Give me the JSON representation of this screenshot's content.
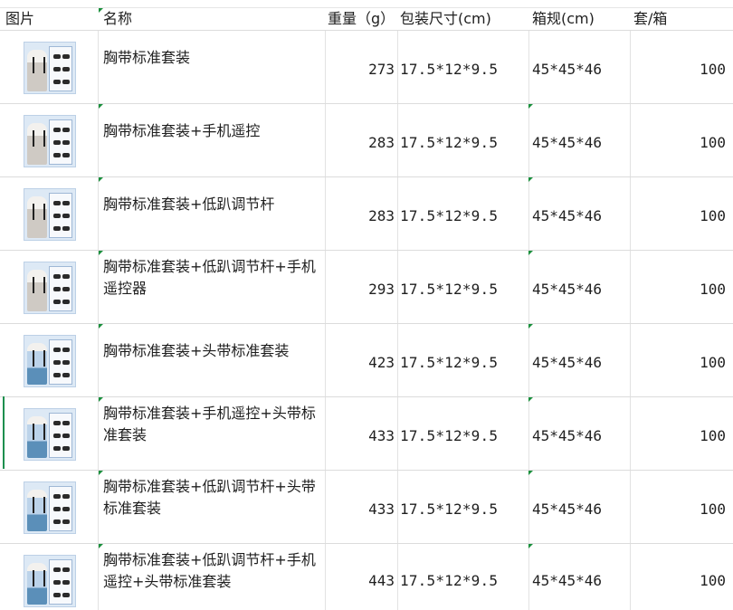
{
  "headers": {
    "picture": "图片",
    "name": "名称",
    "weight": "重量（g）",
    "package_size": "包装尺寸(cm)",
    "box_spec": "箱规(cm)",
    "sets_per_box": "套/箱"
  },
  "rows": [
    {
      "name": "胸带标准套装",
      "weight": "273",
      "package_size": "17.5*12*9.5",
      "box_spec": "45*45*46",
      "sets_per_box": "100"
    },
    {
      "name": "胸带标准套装+手机遥控",
      "weight": "283",
      "package_size": "17.5*12*9.5",
      "box_spec": "45*45*46",
      "sets_per_box": "100"
    },
    {
      "name": "胸带标准套装+低趴调节杆",
      "weight": "283",
      "package_size": "17.5*12*9.5",
      "box_spec": "45*45*46",
      "sets_per_box": "100"
    },
    {
      "name": "胸带标准套装+低趴调节杆+手机遥控器",
      "weight": "293",
      "package_size": "17.5*12*9.5",
      "box_spec": "45*45*46",
      "sets_per_box": "100"
    },
    {
      "name": "胸带标准套装+头带标准套装",
      "weight": "423",
      "package_size": "17.5*12*9.5",
      "box_spec": "45*45*46",
      "sets_per_box": "100"
    },
    {
      "name": "胸带标准套装+手机遥控+头带标准套装",
      "weight": "433",
      "package_size": "17.5*12*9.5",
      "box_spec": "45*45*46",
      "sets_per_box": "100"
    },
    {
      "name": "胸带标准套装+低趴调节杆+头带标准套装",
      "weight": "433",
      "package_size": "17.5*12*9.5",
      "box_spec": "45*45*46",
      "sets_per_box": "100"
    },
    {
      "name": "胸带标准套装+低趴调节杆+手机遥控+头带标准套装",
      "weight": "443",
      "package_size": "17.5*12*9.5",
      "box_spec": "45*45*46",
      "sets_per_box": "100"
    }
  ],
  "colors": {
    "grid_line": "#e2e2e2",
    "comment_marker": "#1a8f3c",
    "selection_bar": "#1d8f4e",
    "image_bg": "#dde9f5"
  },
  "icons": {
    "product_image": "product-photo-icon"
  }
}
